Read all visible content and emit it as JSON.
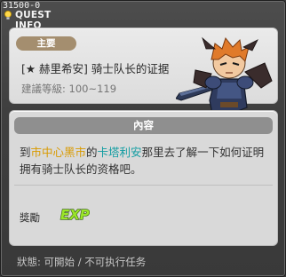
{
  "window": {
    "id_label": "31500-0",
    "title": "QUEST INFO"
  },
  "quest": {
    "category": "主要",
    "name": "[★ 赫里希安] 骑士队长的证据",
    "level_requirement": "建議等級: 100~119"
  },
  "content": {
    "header": "內容",
    "description": {
      "part1": "到",
      "location": "市中心黑市",
      "part2": "的",
      "npc": "卡塔利安",
      "part3": "那里去了解一下如何证明拥有骑士队长的资格吧。"
    },
    "divider": "",
    "reward_label": "獎勵",
    "reward_icon_text": "EXP"
  },
  "status": {
    "label": "狀態:",
    "value1": "可開始",
    "separator": "/",
    "value2": "不可执行任务"
  },
  "colors": {
    "location_color": "#d99a00",
    "npc_color": "#0f9ca1",
    "exp_color": "#9be52a"
  }
}
